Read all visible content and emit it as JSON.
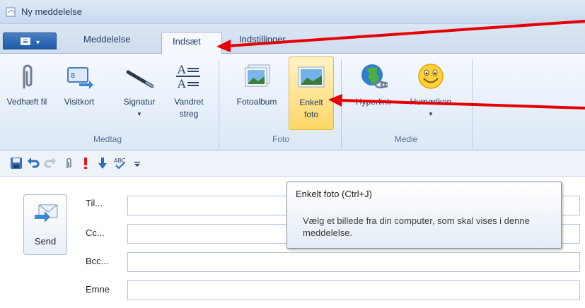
{
  "window": {
    "title": "Ny meddelelse"
  },
  "tabs": [
    {
      "label": "Meddelelse"
    },
    {
      "label": "Indsæt"
    },
    {
      "label": "Indstillinger"
    }
  ],
  "ribbon": {
    "groups": [
      {
        "label": "Medtag",
        "buttons": [
          {
            "label": "Vedhæft fil",
            "icon": "paperclip-icon"
          },
          {
            "label": "Visitkort",
            "icon": "business-card-icon"
          },
          {
            "label": "Signatur",
            "icon": "pen-icon"
          },
          {
            "label": "Vandret streg",
            "icon": "horizontal-line-icon"
          }
        ]
      },
      {
        "label": "Foto",
        "buttons": [
          {
            "label": "Fotoalbum",
            "icon": "photo-album-icon"
          },
          {
            "label": "Enkelt foto",
            "icon": "single-photo-icon"
          }
        ]
      },
      {
        "label": "Medie",
        "buttons": [
          {
            "label": "Hyperlink",
            "icon": "globe-link-icon"
          },
          {
            "label": "Humørikon",
            "icon": "smiley-icon"
          }
        ]
      }
    ]
  },
  "quick_access": [
    "save-icon",
    "undo-icon",
    "redo-icon",
    "attach-icon",
    "high-priority-icon",
    "low-priority-icon",
    "spellcheck-icon",
    "customize-icon"
  ],
  "compose": {
    "send_label": "Send",
    "fields": [
      {
        "label": "Til...",
        "value": ""
      },
      {
        "label": "Cc...",
        "value": ""
      },
      {
        "label": "Bcc...",
        "value": ""
      },
      {
        "label": "Emne",
        "value": ""
      }
    ]
  },
  "tooltip": {
    "title": "Enkelt foto (Ctrl+J)",
    "body": "Vælg et billede fra din computer, som skal vises i denne meddelelse."
  },
  "colors": {
    "annotation_arrow": "#e60000",
    "highlight": "#ffd767",
    "accent": "#1d5aa8"
  }
}
